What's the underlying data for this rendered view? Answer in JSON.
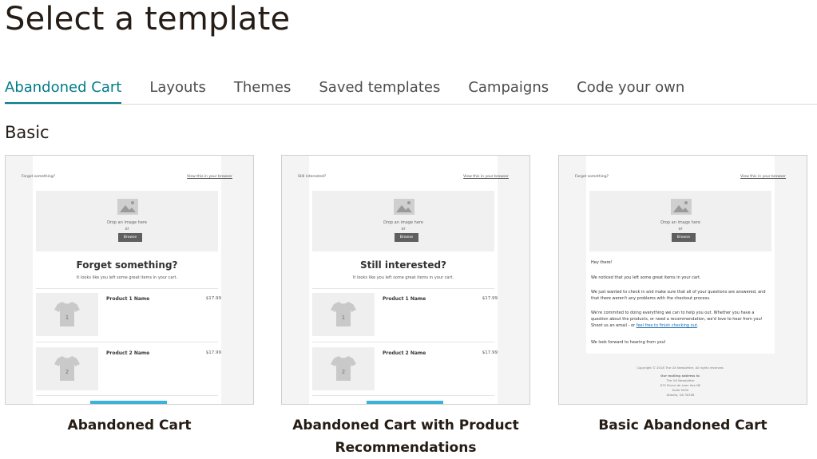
{
  "page": {
    "title": "Select a template"
  },
  "tabs": [
    {
      "label": "Abandoned Cart",
      "active": true
    },
    {
      "label": "Layouts",
      "active": false
    },
    {
      "label": "Themes",
      "active": false
    },
    {
      "label": "Saved templates",
      "active": false
    },
    {
      "label": "Campaigns",
      "active": false
    },
    {
      "label": "Code your own",
      "active": false
    }
  ],
  "section": {
    "heading": "Basic"
  },
  "colors": {
    "accent": "#007c89",
    "cta_button": "#3db2d8"
  },
  "cards": [
    {
      "title": "Abandoned Cart",
      "preview": {
        "preheader_left": "Forgot something?",
        "preheader_right": "View this in your browser",
        "image_text": "Drop an image here",
        "image_or": "or",
        "browse_label": "Browse",
        "heading": "Forget something?",
        "subtext": "It looks like you left some great items in your cart.",
        "products": [
          {
            "name": "Product 1 Name",
            "price": "$17.99",
            "badge": "1"
          },
          {
            "name": "Product 2 Name",
            "price": "$17.99",
            "badge": "2"
          }
        ]
      }
    },
    {
      "title": "Abandoned Cart with Product Recommendations",
      "preview": {
        "preheader_left": "Still interested?",
        "preheader_right": "View this in your browser",
        "image_text": "Drop an image here",
        "image_or": "or",
        "browse_label": "Browse",
        "heading": "Still interested?",
        "subtext": "It looks like you left some great items in your cart.",
        "products": [
          {
            "name": "Product 1 Name",
            "price": "$17.99",
            "badge": "1"
          },
          {
            "name": "Product 2 Name",
            "price": "$17.99",
            "badge": "2"
          }
        ]
      }
    },
    {
      "title": "Basic Abandoned Cart",
      "preview": {
        "preheader_left": "Forgot something?",
        "preheader_right": "View this in your browser",
        "image_text": "Drop an image here",
        "image_or": "or",
        "browse_label": "Browse",
        "greeting": "Hey there!",
        "p1": "We noticed that you left some great items in your cart.",
        "p2": "We just wanted to check in and make sure that all of your questions are answered, and that there weren't any problems with the checkout process.",
        "p3_start": "We're commited to doing everything we can to help you out. Whether you have a question about the products, or need a recommendation, we'd love to hear from you! Shoot us an email - or ",
        "p3_link": "feel free to finish checking out",
        "p3_end": ".",
        "p4": "We look forward to hearing from you!",
        "footer_copyright": "Copyright © 2018 The UX Newsletter, All rights reserved.",
        "footer_mailing": "Our mailing address is:",
        "footer_addr1": "The UX Newsletter",
        "footer_addr2": "675 Ponce de Leon Ave NE",
        "footer_addr3": "Suite 5000",
        "footer_addr4": "Atlanta, GA 30308"
      }
    }
  ]
}
